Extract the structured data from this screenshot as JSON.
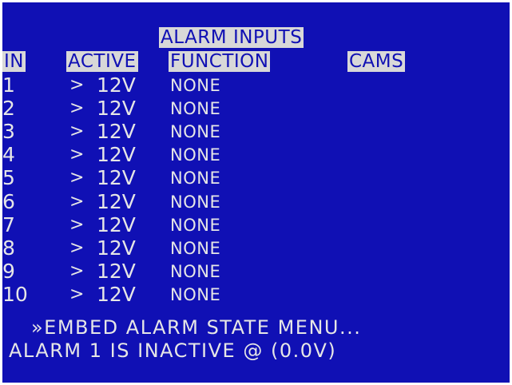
{
  "menu": {
    "title": "ALARM INPUTS",
    "headers": {
      "in": "IN",
      "active": "ACTIVE",
      "function": "FUNCTION",
      "cams": "CAMS"
    },
    "rows": [
      {
        "in": "1",
        "active_symbol": ">",
        "active_voltage": "12V",
        "function": "NONE"
      },
      {
        "in": "2",
        "active_symbol": ">",
        "active_voltage": "12V",
        "function": "NONE"
      },
      {
        "in": "3",
        "active_symbol": ">",
        "active_voltage": "12V",
        "function": "NONE"
      },
      {
        "in": "4",
        "active_symbol": ">",
        "active_voltage": "12V",
        "function": "NONE"
      },
      {
        "in": "5",
        "active_symbol": ">",
        "active_voltage": "12V",
        "function": "NONE"
      },
      {
        "in": "6",
        "active_symbol": ">",
        "active_voltage": "12V",
        "function": "NONE"
      },
      {
        "in": "7",
        "active_symbol": ">",
        "active_voltage": "12V",
        "function": "NONE"
      },
      {
        "in": "8",
        "active_symbol": ">",
        "active_voltage": "12V",
        "function": "NONE"
      },
      {
        "in": "9",
        "active_symbol": ">",
        "active_voltage": "12V",
        "function": "NONE"
      },
      {
        "in": "10",
        "active_symbol": ">",
        "active_voltage": "12V",
        "function": "NONE"
      }
    ],
    "submenu_label": "»EMBED ALARM STATE MENU...",
    "status_text": "ALARM 1 IS INACTIVE @ (0.0V)"
  },
  "colors": {
    "background": "#1010b4",
    "text": "#e6e6e6",
    "highlight_bg": "#d8d8d8",
    "highlight_text": "#1010b4"
  }
}
